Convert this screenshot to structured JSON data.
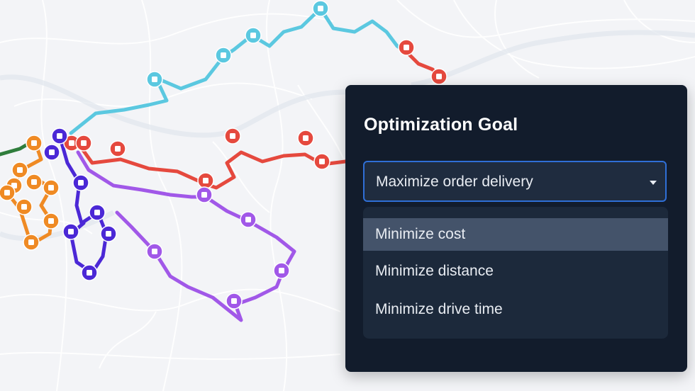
{
  "map": {
    "route_colors": {
      "cyan": "#5bc8e0",
      "red": "#e5493e",
      "purple": "#a158e8",
      "indigo": "#4b28d6",
      "orange": "#ef8a24",
      "green": "#2f7d3c"
    }
  },
  "panel": {
    "title": "Optimization Goal",
    "select": {
      "value": "Maximize order delivery",
      "icon": "caret-down-icon"
    },
    "options": [
      {
        "label": "Minimize cost",
        "highlighted": true
      },
      {
        "label": "Minimize distance",
        "highlighted": false
      },
      {
        "label": "Minimize drive time",
        "highlighted": false
      }
    ]
  }
}
